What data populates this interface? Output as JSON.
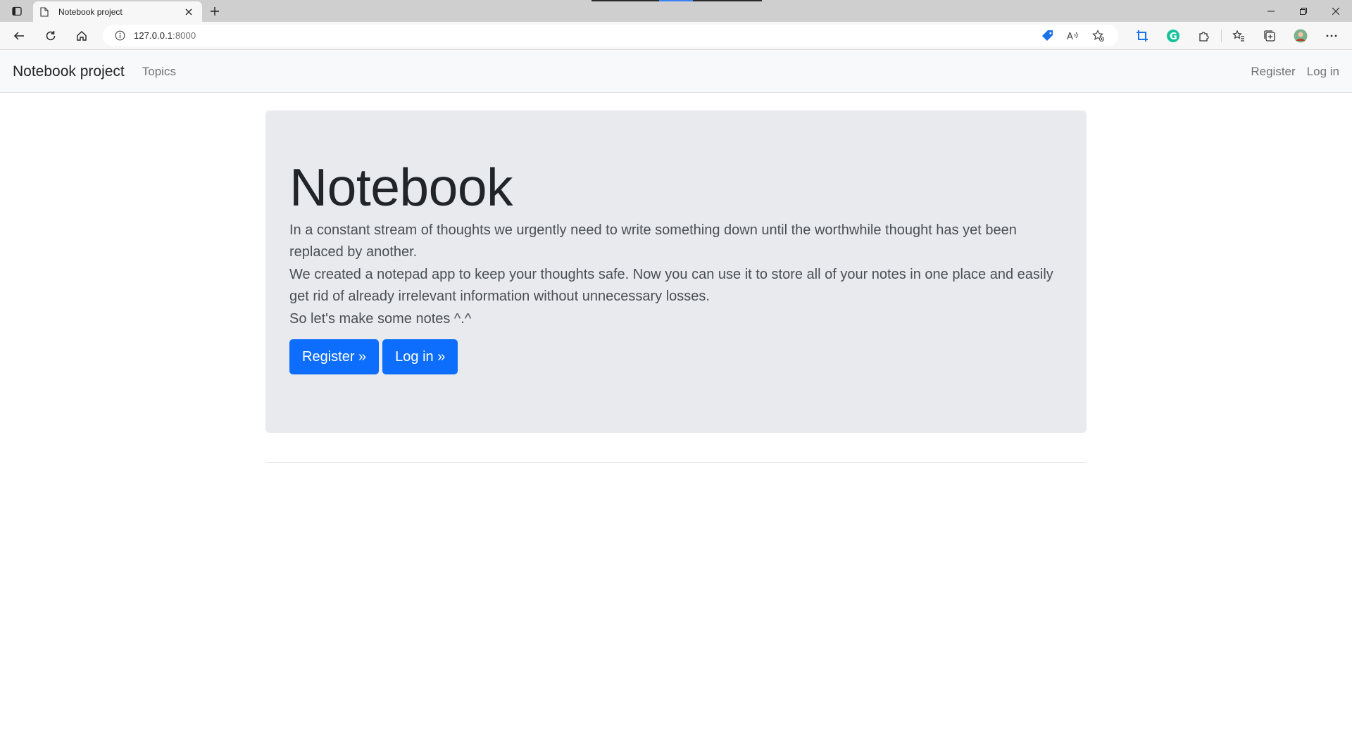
{
  "browser": {
    "tab_title": "Notebook project",
    "url_host": "127.0.0.1",
    "url_port": ":8000"
  },
  "navbar": {
    "brand": "Notebook project",
    "topics_label": "Topics",
    "register_label": "Register",
    "login_label": "Log in"
  },
  "jumbotron": {
    "heading": "Notebook",
    "paragraph_1": "In a constant stream of thoughts we urgently need to write something down until the worthwhile thought has yet been replaced by another.",
    "paragraph_2": "We created a notepad app to keep your thoughts safe. Now you can use it to store all of your notes in one place and easily get rid of already irrelevant information without unnecessary losses.",
    "paragraph_3": "So let's make some notes ^.^",
    "register_button": "Register »",
    "login_button": "Log in »"
  },
  "colors": {
    "primary": "#0d6efd",
    "jumbotron_bg": "#e8eaed",
    "navbar_bg": "#f8f9fa"
  }
}
